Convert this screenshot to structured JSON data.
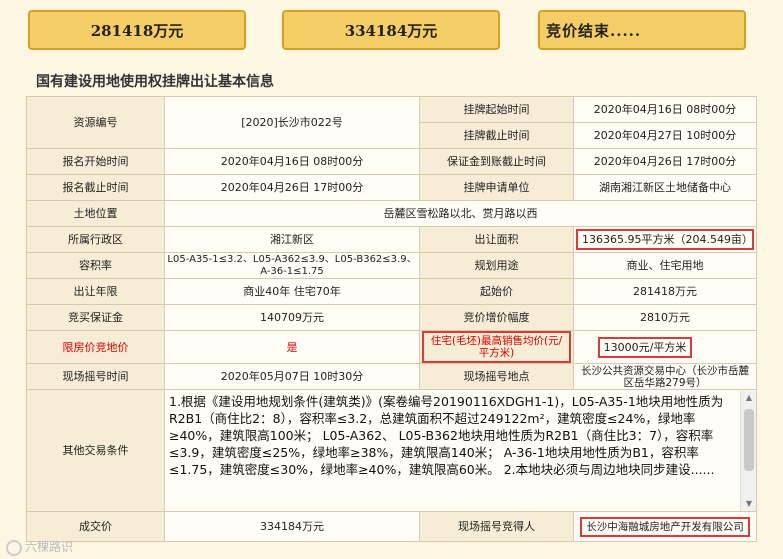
{
  "summary": {
    "start_price": "281418万元",
    "deal_price": "334184万元",
    "status": "竞价结束....."
  },
  "section_title": "国有建设用地使用权挂牌出让基本信息",
  "rows": {
    "resource_no_label": "资源编号",
    "resource_no": "[2020]长沙市022号",
    "listing_start_label": "挂牌起始时间",
    "listing_start": "2020年04月16日 08时00分",
    "listing_end_label": "挂牌截止时间",
    "listing_end": "2020年04月27日 10时00分",
    "apply_start_label": "报名开始时间",
    "apply_start": "2020年04月16日 08时00分",
    "deposit_deadline_label": "保证金到账截止时间",
    "deposit_deadline": "2020年04月26日 17时00分",
    "apply_end_label": "报名截止时间",
    "apply_end": "2020年04月26日 17时00分",
    "apply_unit_label": "挂牌申请单位",
    "apply_unit": "湖南湘江新区土地储备中心",
    "location_label": "土地位置",
    "location": "岳麓区雪松路以北、赏月路以西",
    "district_label": "所属行政区",
    "district": "湘江新区",
    "area_label": "出让面积",
    "area": "136365.95平方米（204.549亩）",
    "far_label": "容积率",
    "far": "L05-A35-1≤3.2、L05-A362≤3.9、L05-B362≤3.9、A-36-1≤1.75",
    "use_label": "规划用途",
    "use": "商业、住宅用地",
    "term_label": "出让年限",
    "term": "商业40年 住宅70年",
    "start_price_label": "起始价",
    "start_price": "281418万元",
    "bid_deposit_label": "竞买保证金",
    "bid_deposit": "140709万元",
    "increment_label": "竞价增价幅度",
    "increment": "2810万元",
    "limit_label": "限房价竞地价",
    "limit": "是",
    "max_price_label": "住宅(毛坯)最高销售均价(元/平方米)",
    "max_price": "13000元/平方米",
    "draw_time_label": "现场摇号时间",
    "draw_time": "2020年05月07日 10时30分",
    "draw_place_label": "现场摇号地点",
    "draw_place": "长沙公共资源交易中心（长沙市岳麓区岳华路279号）",
    "conditions_label": "其他交易条件",
    "conditions": "1.根据《建设用地规划条件(建筑类)》(案卷编号20190116XDGH1-1)，L05-A35-1地块用地性质为R2B1（商住比2：8），容积率≤3.2，总建筑面积不超过249122m²，建筑密度≤24%，绿地率≥40%，建筑限高100米； L05-A362、 L05-B362地块用地性质为R2B1（商住比3：7），容积率≤3.9，建筑密度≤25%，绿地率≥38%，建筑限高140米； A-36-1地块用地性质为B1，容积率≤1.75，建筑密度≤30%，绿地率≥40%，建筑限高60米。 2.本地块必须与周边地块同步建设......",
    "deal_price_label": "成交价",
    "deal_price": "334184万元",
    "winner_label": "现场摇号竞得人",
    "winner": "长沙中海融城房地产开发有限公司"
  },
  "watermark": "六棵路识"
}
